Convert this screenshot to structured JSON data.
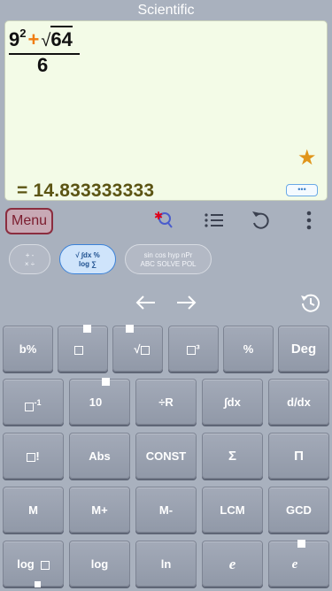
{
  "title": "Scientific",
  "display": {
    "expression": {
      "base": "9",
      "exponent": "2",
      "plus": "+",
      "radical": "√",
      "radicand": "64",
      "denominator": "6"
    },
    "result": "= 14.833333333",
    "more_label": "•••"
  },
  "toolbar": {
    "menu_label": "Menu"
  },
  "modes": [
    {
      "line1": "+ -",
      "line2": "× ÷"
    },
    {
      "line1": "√ ∫dx %",
      "line2": "log ∑"
    },
    {
      "line1": "sin cos hyp nPr",
      "line2": "ABC SOLVE POL"
    }
  ],
  "keys": {
    "row1": [
      "b%",
      "",
      "",
      "",
      "%",
      "Deg"
    ],
    "row2": [
      "",
      "10",
      "÷R",
      "∫dx",
      "d/dx"
    ],
    "row3": [
      "",
      "Abs",
      "CONST",
      "Σ",
      "Π"
    ],
    "row4": [
      "M",
      "M+",
      "M-",
      "LCM",
      "GCD"
    ],
    "row5": [
      "log",
      "log",
      "ln",
      "e",
      "e"
    ],
    "pow3_suffix": "³",
    "inv_suffix": "-1",
    "fact_suffix": "!"
  },
  "colors": {
    "background": "#a9b1be",
    "display_bg": "#f3fbe7",
    "result_text": "#5b5413",
    "plus_sign": "#f07d12",
    "star": "#e0951a",
    "active_mode": "#3b82d9"
  }
}
